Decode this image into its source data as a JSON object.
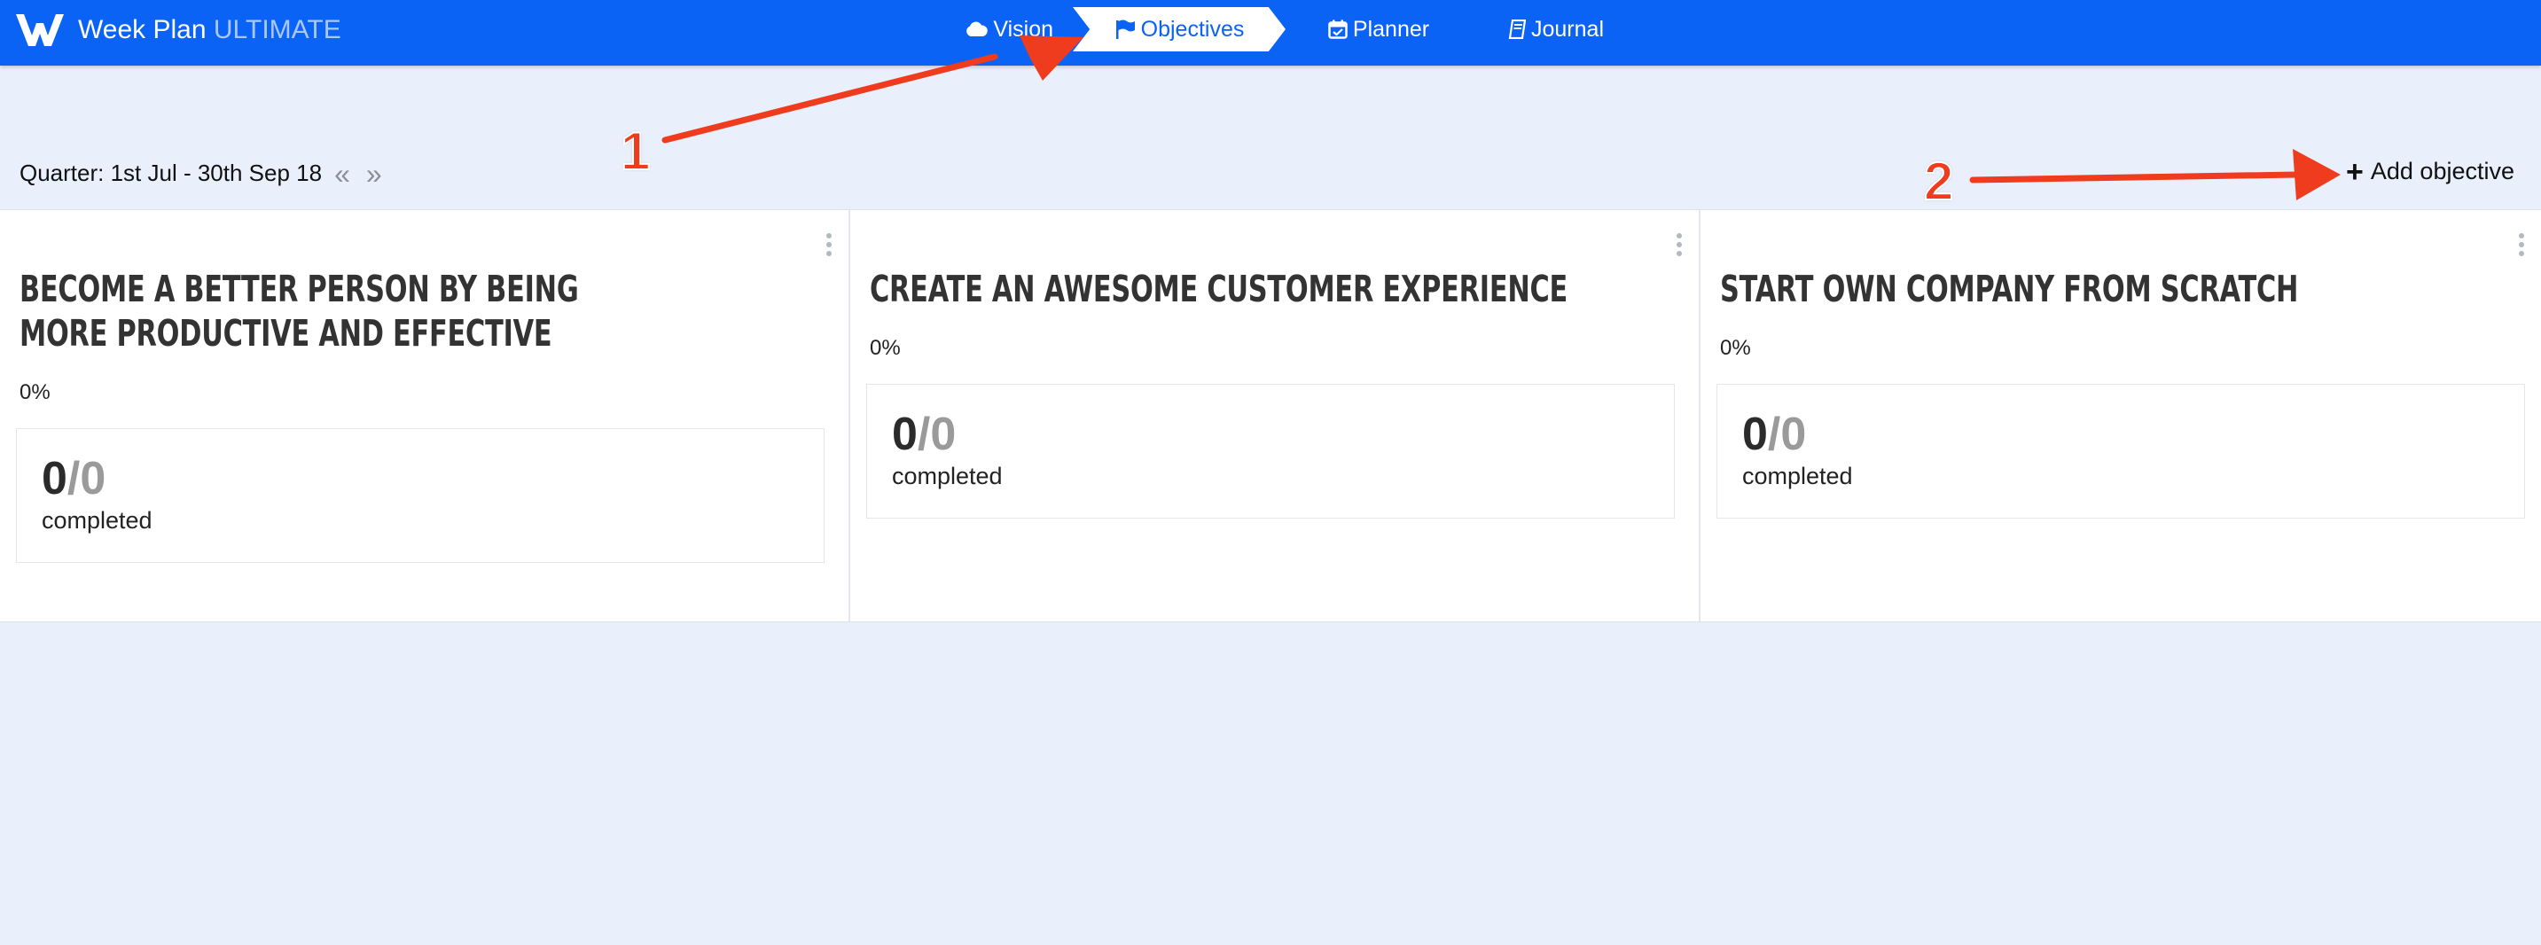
{
  "app": {
    "name": "Week Plan",
    "edition": "ULTIMATE"
  },
  "nav": {
    "items": [
      {
        "label": "Vision",
        "icon": "cloud-icon"
      },
      {
        "label": "Objectives",
        "icon": "flag-icon"
      },
      {
        "label": "Planner",
        "icon": "calendar-check-icon"
      },
      {
        "label": "Journal",
        "icon": "book-icon"
      }
    ]
  },
  "quarter": {
    "label": "Quarter: 1st Jul - 30th Sep 18",
    "prev_icon": "double-chevron-left-icon",
    "next_icon": "double-chevron-right-icon"
  },
  "actions": {
    "add_objective": "Add objective"
  },
  "objectives": [
    {
      "title": "Become a better person by being more productive and effective",
      "percent": "0%",
      "done": "0",
      "total": "/0",
      "completed_label": "completed"
    },
    {
      "title": "Create an awesome customer experience",
      "percent": "0%",
      "done": "0",
      "total": "/0",
      "completed_label": "completed"
    },
    {
      "title": "Start own company from scratch",
      "percent": "0%",
      "done": "0",
      "total": "/0",
      "completed_label": "completed"
    }
  ],
  "annotations": {
    "one": "1",
    "two": "2",
    "color": "#ef3b1e"
  },
  "colors": {
    "brand": "#0b63f6",
    "background": "#e9f0fc"
  }
}
